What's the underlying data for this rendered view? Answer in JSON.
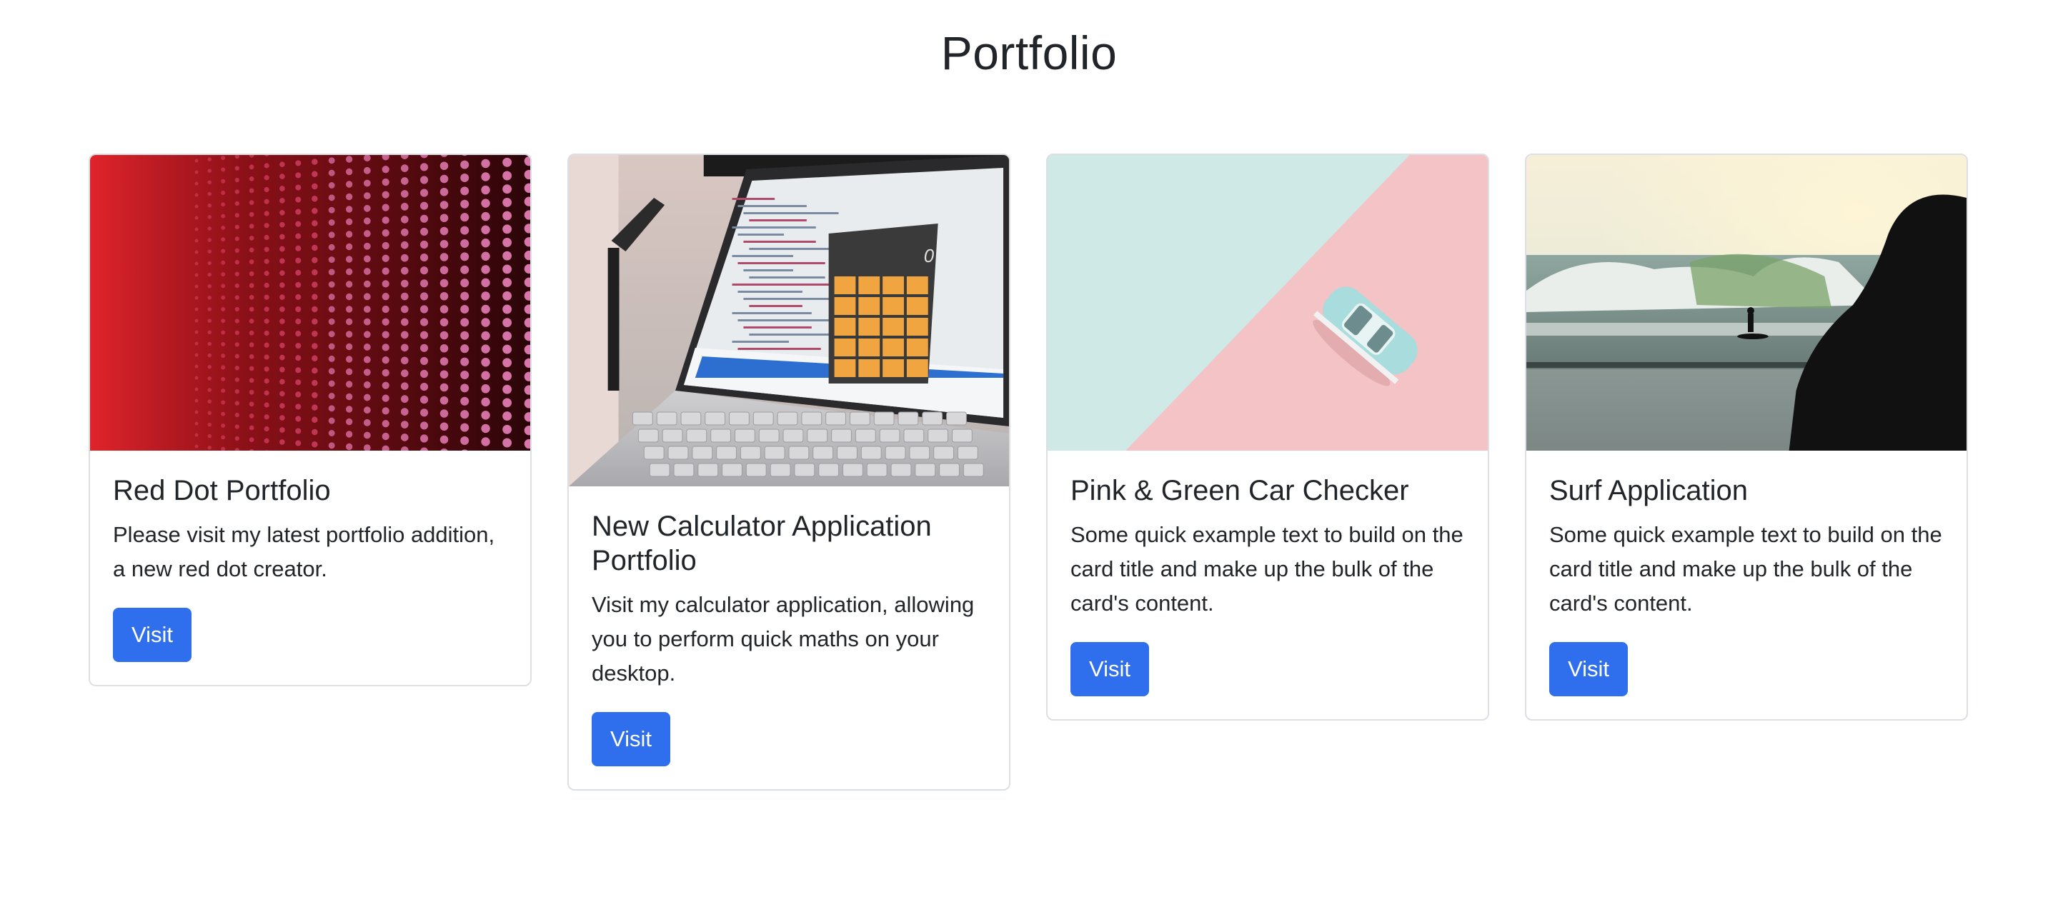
{
  "page": {
    "title": "Portfolio"
  },
  "colors": {
    "accent": "#2f6fed",
    "text": "#212529",
    "border": "#dcdfe3"
  },
  "cards": [
    {
      "title": "Red Dot Portfolio",
      "text": "Please visit my latest portfolio addition, a new red dot creator.",
      "button_label": "Visit",
      "image": "red-led-dot-wall-image"
    },
    {
      "title": "New Calculator Application Portfolio",
      "text": "Visit my calculator application, allowing you to perform quick maths on your desktop.",
      "button_label": "Visit",
      "image": "laptop-calculator-image",
      "calculator_display": "0"
    },
    {
      "title": "Pink & Green Car Checker",
      "text": "Some quick example text to build on the card title and make up the bulk of the card's content.",
      "button_label": "Visit",
      "image": "toy-car-pink-green-image"
    },
    {
      "title": "Surf Application",
      "text": "Some quick example text to build on the card title and make up the bulk of the card's content.",
      "button_label": "Visit",
      "image": "surfer-wave-image"
    }
  ]
}
